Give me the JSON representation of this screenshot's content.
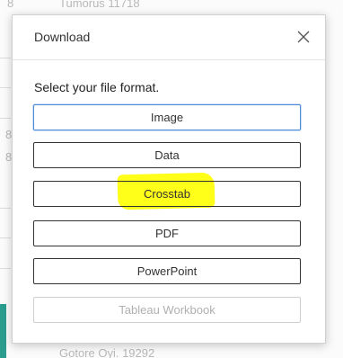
{
  "background": {
    "top_text": "Tumorus 11718",
    "bottom_text": "Gotore Oyi. 19292",
    "left_digit_1": "8",
    "left_digit_2": "8",
    "left_digit_3": "8"
  },
  "dialog": {
    "title": "Download",
    "close_icon": "close-icon",
    "prompt": "Select your file format.",
    "formats": [
      {
        "label": "Image",
        "state": "selected"
      },
      {
        "label": "Data",
        "state": "normal"
      },
      {
        "label": "Crosstab",
        "state": "highlighted"
      },
      {
        "label": "PDF",
        "state": "normal"
      },
      {
        "label": "PowerPoint",
        "state": "normal"
      },
      {
        "label": "Tableau Workbook",
        "state": "disabled"
      }
    ]
  },
  "colors": {
    "highlight": "#ffff1a",
    "selected_border": "#4a8bd6",
    "accent": "#2a9d8f"
  }
}
